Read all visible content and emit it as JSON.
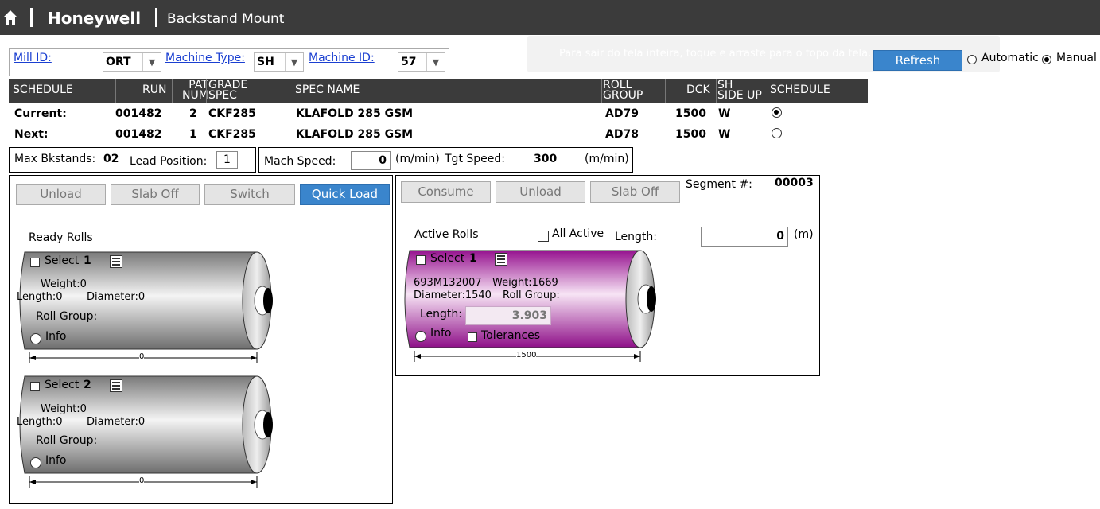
{
  "header": {
    "app_name": "Honeywell",
    "page_title": "Backstand Mount"
  },
  "filters": {
    "mill_label": "Mill ID:",
    "mill_value": "ORT",
    "machine_type_label": "Machine Type:",
    "machine_type_value": "SH",
    "machine_id_label": "Machine ID:",
    "machine_id_value": "57"
  },
  "toast": {
    "text": "Para sair do tela inteira, toque e arraste para o topo da tela."
  },
  "controls": {
    "refresh_label": "Refresh",
    "automatic_label": "Automatic",
    "manual_label": "Manual",
    "mode_selected": "Manual"
  },
  "schedule_table": {
    "headers": {
      "schedule": "SCHEDULE",
      "run": "RUN",
      "pat_1": "PAT",
      "pat_2": "NUM",
      "grade_1": "GRADE",
      "grade_2": "SPEC",
      "spec_name": "SPEC NAME",
      "roll_1": "ROLL",
      "roll_2": "GROUP",
      "dck": "DCK",
      "sh_1": "SH",
      "sh_2": "SIDE UP",
      "schedule2": "SCHEDULE"
    },
    "rows": [
      {
        "label": "Current:",
        "run": "001482",
        "pat": "2",
        "grade": "CKF285",
        "spec_name": "KLAFOLD 285 GSM",
        "roll_group": "AD79",
        "dck": "1500",
        "side": "W",
        "selected": true
      },
      {
        "label": "Next:",
        "run": "001482",
        "pat": "1",
        "grade": "CKF285",
        "spec_name": "KLAFOLD 285 GSM",
        "roll_group": "AD78",
        "dck": "1500",
        "side": "W",
        "selected": false
      }
    ]
  },
  "info_bar": {
    "max_bkstands_label": "Max Bkstands:",
    "max_bkstands_value": "02",
    "lead_position_label": "Lead Position:",
    "lead_position_value": "1",
    "mach_speed_label": "Mach Speed:",
    "mach_speed_value": "0",
    "mach_speed_unit": "(m/min)",
    "tgt_speed_label": "Tgt Speed:",
    "tgt_speed_value": "300",
    "tgt_speed_unit": "(m/min)"
  },
  "left_panel": {
    "buttons": {
      "unload": "Unload",
      "slab_off": "Slab Off",
      "switch": "Switch",
      "quick_load": "Quick Load"
    },
    "title": "Ready Rolls",
    "rolls": [
      {
        "select_label": "Select",
        "number": "1",
        "weight": "Weight:0",
        "length": "Length:0",
        "diameter": "Diameter:0",
        "roll_group": "Roll Group:",
        "info": "Info",
        "width_value": "0"
      },
      {
        "select_label": "Select",
        "number": "2",
        "weight": "Weight:0",
        "length": "Length:0",
        "diameter": "Diameter:0",
        "roll_group": "Roll Group:",
        "info": "Info",
        "width_value": "0"
      }
    ]
  },
  "right_panel": {
    "buttons": {
      "consume": "Consume",
      "unload": "Unload",
      "slab_off": "Slab Off"
    },
    "segment_label": "Segment #:",
    "segment_value": "00003",
    "title": "Active Rolls",
    "all_active_label": "All Active",
    "length_label": "Length:",
    "length_value": "0",
    "length_unit": "(m)",
    "roll": {
      "select_label": "Select",
      "number": "1",
      "roll_id": "693M132007",
      "weight": "Weight:1669",
      "diameter": "Diameter:1540",
      "roll_group": "Roll Group:",
      "length_label": "Length:",
      "length_value": "3.903",
      "info": "Info",
      "tolerances": "Tolerances",
      "width_value": "1500"
    }
  },
  "colors": {
    "header_bg": "#3b3b3b",
    "accent": "#3a85cc",
    "active_roll": "#a0189a",
    "ready_roll": "#8a8a8a"
  }
}
